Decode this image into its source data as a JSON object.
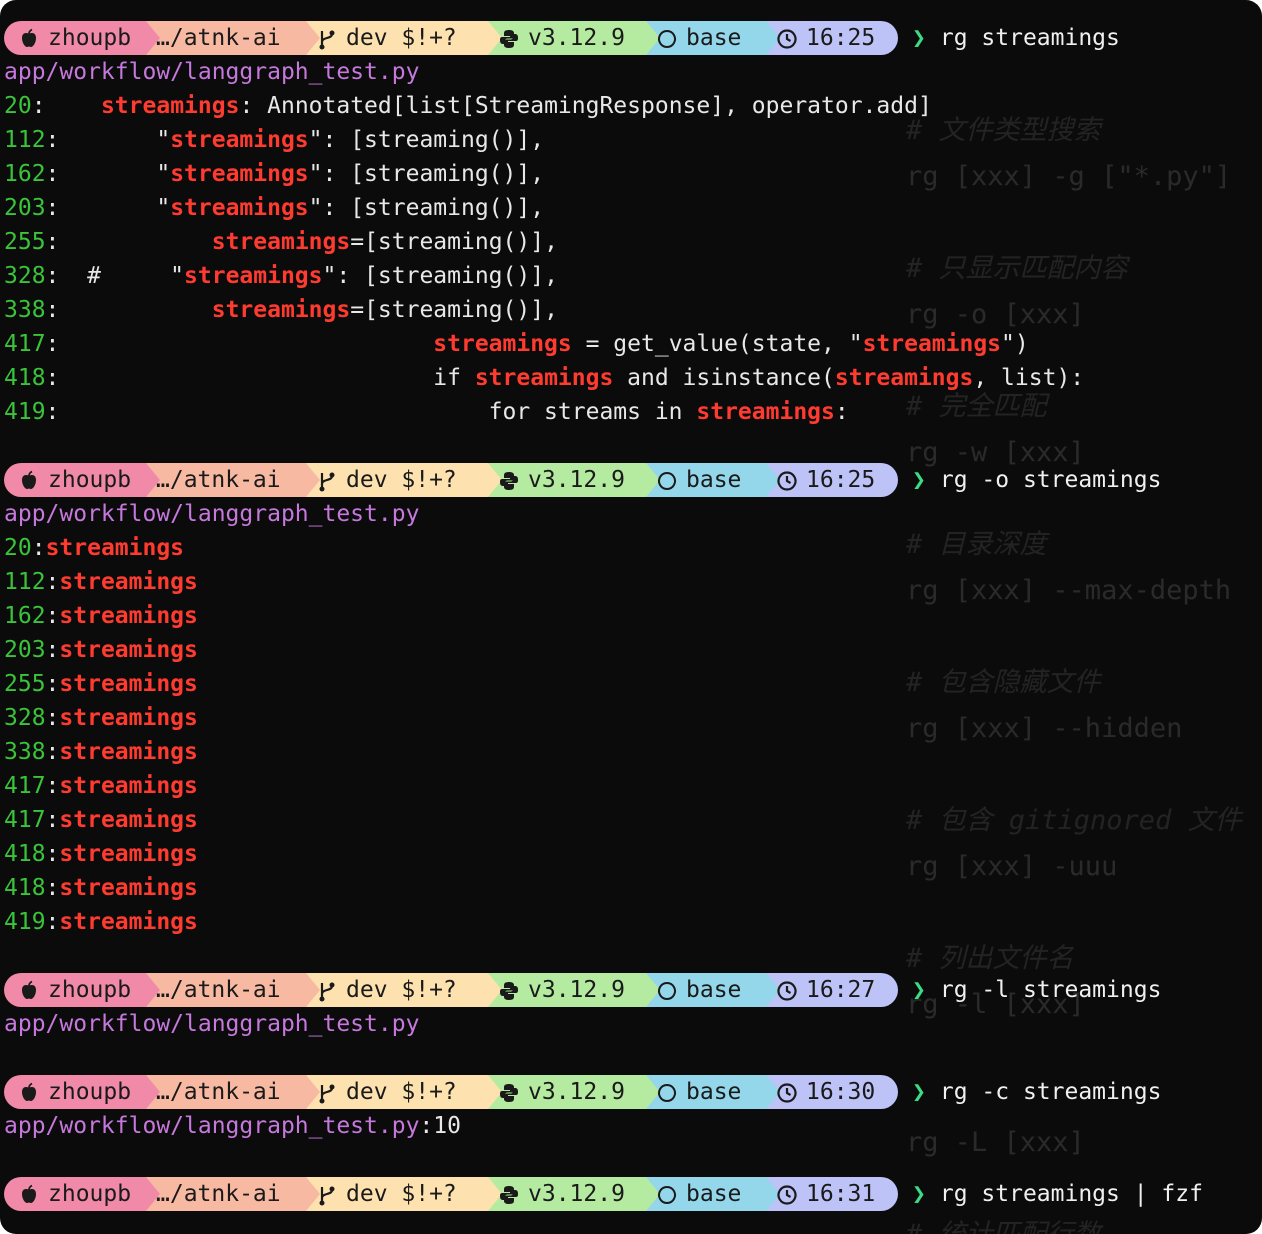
{
  "prompt": {
    "user": "zhoupb",
    "dir": "…/atnk-ai",
    "git": "dev $!+?",
    "python": "v3.12.9",
    "conda": "base",
    "caret": "❯"
  },
  "colors": {
    "path": "#c678dd",
    "line_number": "#39c439",
    "match": "#ff3b30",
    "prompt_user": "#f08aa8",
    "prompt_dir": "#f8b9a2",
    "prompt_git": "#fde2b0",
    "prompt_python": "#b5eba0",
    "prompt_conda": "#94d6ea",
    "prompt_time": "#bdc2f7"
  },
  "icons": {
    "user": "apple-icon",
    "git": "git-branch-icon",
    "python": "python-icon",
    "conda": "circle-icon",
    "time": "clock-icon"
  },
  "blocks": [
    {
      "time": "16:25",
      "command": "rg streamings",
      "output": [
        {
          "type": "path",
          "text": "app/workflow/langgraph_test.py"
        },
        {
          "type": "code",
          "num": "20",
          "segs": [
            {
              "t": "    "
            },
            {
              "t": "streamings",
              "m": true
            },
            {
              "t": ": Annotated[list[StreamingResponse], operator.add]"
            }
          ]
        },
        {
          "type": "code",
          "num": "112",
          "segs": [
            {
              "t": "       \""
            },
            {
              "t": "streamings",
              "m": true
            },
            {
              "t": "\": [streaming()],"
            }
          ]
        },
        {
          "type": "code",
          "num": "162",
          "segs": [
            {
              "t": "       \""
            },
            {
              "t": "streamings",
              "m": true
            },
            {
              "t": "\": [streaming()],"
            }
          ]
        },
        {
          "type": "code",
          "num": "203",
          "segs": [
            {
              "t": "       \""
            },
            {
              "t": "streamings",
              "m": true
            },
            {
              "t": "\": [streaming()],"
            }
          ]
        },
        {
          "type": "code",
          "num": "255",
          "segs": [
            {
              "t": "           "
            },
            {
              "t": "streamings",
              "m": true
            },
            {
              "t": "=[streaming()],"
            }
          ]
        },
        {
          "type": "code",
          "num": "328",
          "segs": [
            {
              "t": "  #     \""
            },
            {
              "t": "streamings",
              "m": true
            },
            {
              "t": "\": [streaming()],"
            }
          ]
        },
        {
          "type": "code",
          "num": "338",
          "segs": [
            {
              "t": "           "
            },
            {
              "t": "streamings",
              "m": true
            },
            {
              "t": "=[streaming()],"
            }
          ]
        },
        {
          "type": "code",
          "num": "417",
          "segs": [
            {
              "t": "                           "
            },
            {
              "t": "streamings",
              "m": true
            },
            {
              "t": " = get_value(state, \""
            },
            {
              "t": "streamings",
              "m": true
            },
            {
              "t": "\")"
            }
          ]
        },
        {
          "type": "code",
          "num": "418",
          "segs": [
            {
              "t": "                           if "
            },
            {
              "t": "streamings",
              "m": true
            },
            {
              "t": " and isinstance("
            },
            {
              "t": "streamings",
              "m": true
            },
            {
              "t": ", list):"
            }
          ]
        },
        {
          "type": "code",
          "num": "419",
          "segs": [
            {
              "t": "                               for streams in "
            },
            {
              "t": "streamings",
              "m": true
            },
            {
              "t": ":"
            }
          ]
        }
      ]
    },
    {
      "time": "16:25",
      "command": "rg -o streamings",
      "output": [
        {
          "type": "path",
          "text": "app/workflow/langgraph_test.py"
        },
        {
          "type": "only",
          "num": "20",
          "text": "streamings"
        },
        {
          "type": "only",
          "num": "112",
          "text": "streamings"
        },
        {
          "type": "only",
          "num": "162",
          "text": "streamings"
        },
        {
          "type": "only",
          "num": "203",
          "text": "streamings"
        },
        {
          "type": "only",
          "num": "255",
          "text": "streamings"
        },
        {
          "type": "only",
          "num": "328",
          "text": "streamings"
        },
        {
          "type": "only",
          "num": "338",
          "text": "streamings"
        },
        {
          "type": "only",
          "num": "417",
          "text": "streamings"
        },
        {
          "type": "only",
          "num": "417",
          "text": "streamings"
        },
        {
          "type": "only",
          "num": "418",
          "text": "streamings"
        },
        {
          "type": "only",
          "num": "418",
          "text": "streamings"
        },
        {
          "type": "only",
          "num": "419",
          "text": "streamings"
        }
      ]
    },
    {
      "time": "16:27",
      "command": "rg -l streamings",
      "output": [
        {
          "type": "path",
          "text": "app/workflow/langgraph_test.py"
        }
      ]
    },
    {
      "time": "16:30",
      "command": "rg -c streamings",
      "output": [
        {
          "type": "pathcount",
          "text": "app/workflow/langgraph_test.py",
          "count": ":10"
        }
      ]
    },
    {
      "time": "16:31",
      "command": "rg streamings | fzf",
      "output": []
    }
  ],
  "background_overlay": [
    {
      "num": "",
      "text": "",
      "comment": false
    },
    {
      "num": "",
      "text": "# 文件类型搜索",
      "comment": true
    },
    {
      "num": "",
      "text": "rg [xxx] -g [\"*.py\"]",
      "comment": false
    },
    {
      "num": "",
      "text": "# 只显示匹配内容",
      "comment": true
    },
    {
      "num": "",
      "text": "rg -o [xxx]",
      "comment": false
    },
    {
      "num": "",
      "text": "# 完全匹配",
      "comment": true
    },
    {
      "num": "",
      "text": "rg -w [xxx]",
      "comment": false
    },
    {
      "num": "",
      "text": "# 目录深度",
      "comment": true
    },
    {
      "num": "",
      "text": "rg [xxx] --max-depth",
      "comment": false
    },
    {
      "num": "",
      "text": "# 包含隐藏文件",
      "comment": true
    },
    {
      "num": "",
      "text": "rg [xxx] --hidden",
      "comment": false
    },
    {
      "num": "",
      "text": "# 包含 gitignored 文件",
      "comment": true
    },
    {
      "num": "",
      "text": "rg [xxx] -uuu",
      "comment": false
    },
    {
      "num": "",
      "text": "# 列出文件名",
      "comment": true
    },
    {
      "num": "",
      "text": "rg -l [xxx]",
      "comment": false
    },
    {
      "num": "",
      "text": "rg -L [xxx]",
      "comment": false
    },
    {
      "num": "",
      "text": "# 统计匹配行数",
      "comment": true
    }
  ]
}
